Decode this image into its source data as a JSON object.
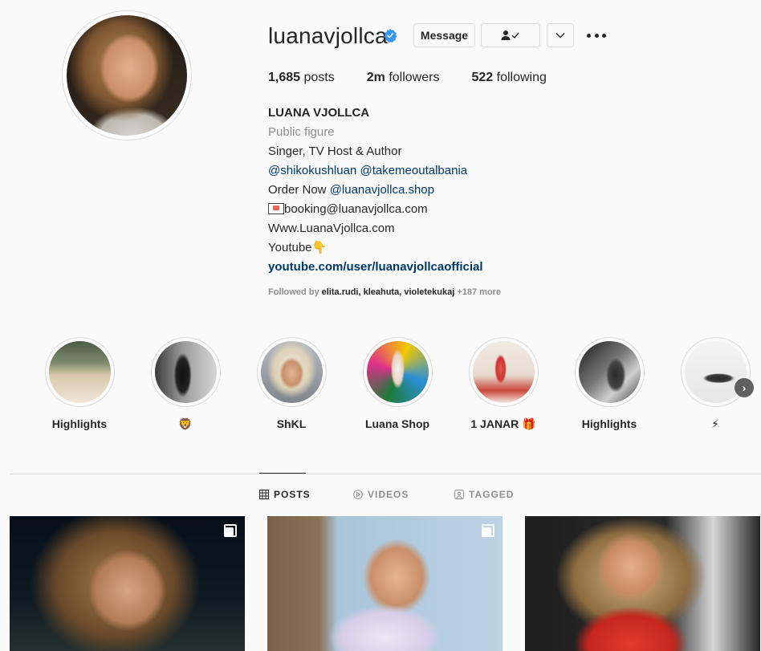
{
  "profile": {
    "username": "luanavjollca",
    "message_label": "Message",
    "stats": [
      {
        "value": "1,685",
        "label": "posts"
      },
      {
        "value": "2m",
        "label": "followers"
      },
      {
        "value": "522",
        "label": "following"
      }
    ],
    "full_name": "LUANA VJOLLCA",
    "category": "Public figure",
    "bio_line_1": "Singer, TV Host & Author",
    "mention_1": "@shikokushluan",
    "mention_2": "@takemeoutalbania",
    "order_text": "Order Now ",
    "order_link": "@luanavjollca.shop",
    "email": "booking@luanavjollca.com",
    "website_text": "Www.LuanaVjollca.com",
    "youtube_text": "Youtube",
    "youtube_emoji": "👇",
    "link": "youtube.com/user/luanavjollcaofficial",
    "followed_by_prefix": "Followed by ",
    "followed_by_names": "elita.rudi, kleahuta, violetekukaj",
    "followed_by_more": " +187 more"
  },
  "highlights": [
    {
      "label": "Highlights"
    },
    {
      "label": "🦁"
    },
    {
      "label": "ShKL"
    },
    {
      "label": "Luana Shop"
    },
    {
      "label": "1 JANAR 🎁"
    },
    {
      "label": "Highlights"
    },
    {
      "label": "⚡"
    }
  ],
  "tabs": {
    "posts": "POSTS",
    "videos": "VIDEOS",
    "tagged": "TAGGED"
  },
  "icons": {
    "verified": "verified-badge-icon",
    "follow_status": "person-check-icon",
    "dropdown": "chevron-down-icon",
    "more": "more-horizontal-icon",
    "next": "chevron-right-icon",
    "multi_post": "carousel-icon"
  },
  "colors": {
    "verified": "#3897f0",
    "link": "#00376b",
    "secondary_text": "#8e8e8e"
  }
}
